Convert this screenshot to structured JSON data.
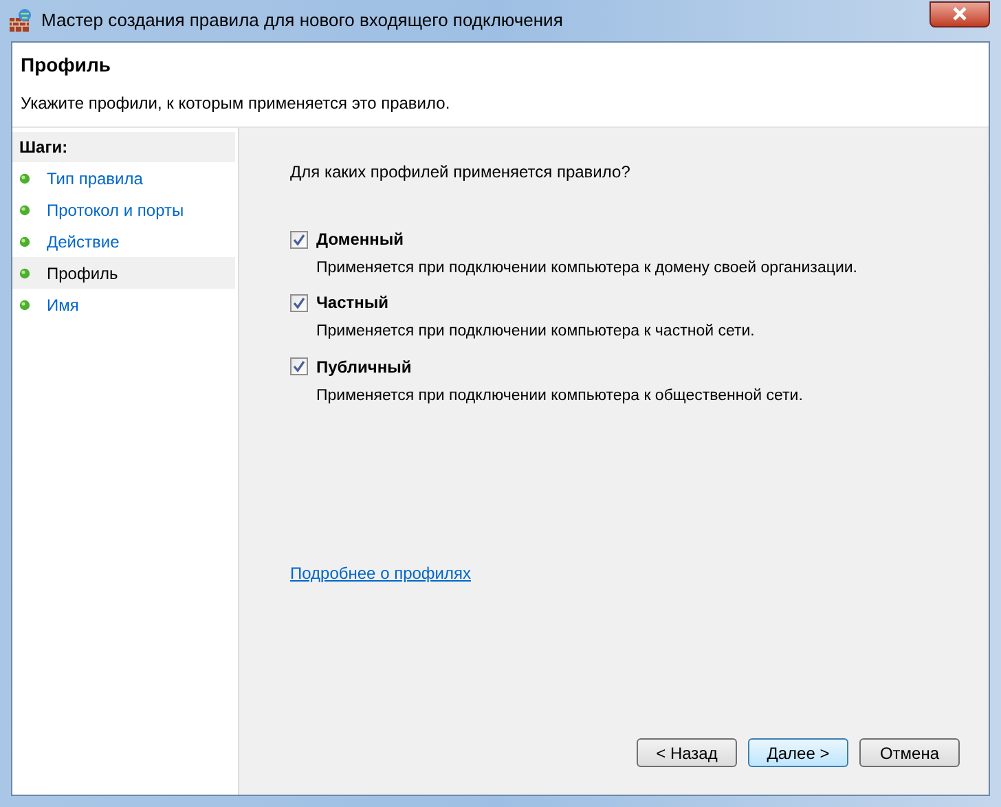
{
  "window": {
    "title": "Мастер создания правила для нового входящего подключения"
  },
  "header": {
    "title": "Профиль",
    "subtitle": "Укажите профили, к которым применяется это правило."
  },
  "steps": {
    "title": "Шаги:",
    "items": [
      {
        "label": "Тип правила",
        "selected": false
      },
      {
        "label": "Протокол и порты",
        "selected": false
      },
      {
        "label": "Действие",
        "selected": false
      },
      {
        "label": "Профиль",
        "selected": true
      },
      {
        "label": "Имя",
        "selected": false
      }
    ]
  },
  "question": "Для каких профилей применяется правило?",
  "profiles": [
    {
      "label": "Доменный",
      "checked": true,
      "description": "Применяется при подключении компьютера к домену своей организации."
    },
    {
      "label": "Частный",
      "checked": true,
      "description": "Применяется при подключении компьютера к частной сети."
    },
    {
      "label": "Публичный",
      "checked": true,
      "description": "Применяется при подключении компьютера к общественной сети."
    }
  ],
  "link": "Подробнее о профилях",
  "buttons": [
    {
      "label": "< Назад",
      "default": false
    },
    {
      "label": "Далее >",
      "default": true
    },
    {
      "label": "Отмена",
      "default": false
    }
  ]
}
